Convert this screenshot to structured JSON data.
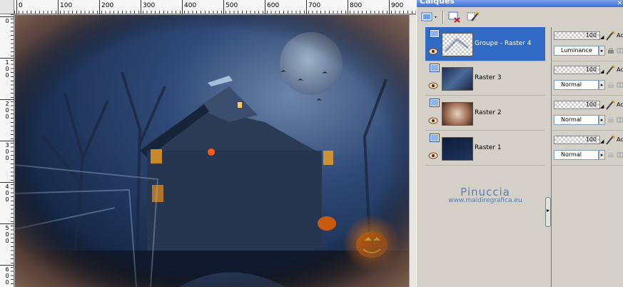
{
  "panel": {
    "title": "Calques"
  },
  "ruler_h": [
    "0",
    "100",
    "200",
    "300",
    "400",
    "500",
    "600",
    "700",
    "800",
    "900"
  ],
  "ruler_v": [
    "0",
    "100",
    "200",
    "300",
    "400",
    "500",
    "600"
  ],
  "layers": [
    {
      "name": "Groupe - Raster 4",
      "selected": true,
      "opacity": "100",
      "blend": "Luminance"
    },
    {
      "name": "Raster 3",
      "selected": false,
      "opacity": "100",
      "blend": "Normal"
    },
    {
      "name": "Raster 2",
      "selected": false,
      "opacity": "100",
      "blend": "Normal"
    },
    {
      "name": "Raster 1",
      "selected": false,
      "opacity": "100",
      "blend": "Normal"
    }
  ],
  "props_ac_label": "Ac",
  "watermark": {
    "name": "Pinuccia",
    "url": "www.maidiregrafica.eu"
  },
  "colors": {
    "selection": "#316ac5",
    "panel_bg": "#d4d0c8",
    "title_bar": "#3a6fd8",
    "watermark": "#5b7cae"
  },
  "icons": [
    "new-layer-icon",
    "delete-layer-icon",
    "edit-layer-icon",
    "visibility-eye-icon",
    "layer-type-icon",
    "paint-brush-icon",
    "lock-icon",
    "link-icon"
  ]
}
